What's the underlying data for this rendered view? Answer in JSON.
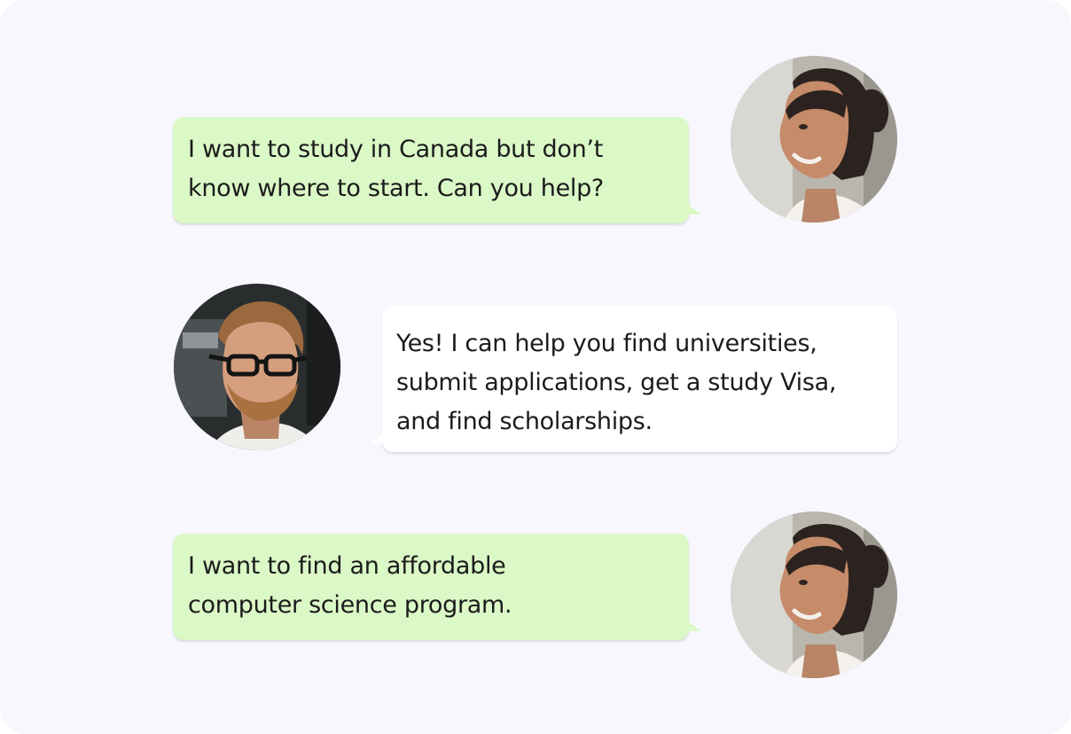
{
  "colors": {
    "background": "#f8f7fd",
    "user_bubble": "#dbf8c7",
    "agent_bubble": "#ffffff",
    "text": "#1b1b1b"
  },
  "messages": [
    {
      "sender": "student",
      "text": "I want to study in Canada but don’t\nknow where to start. Can you help?",
      "avatar_icon": "student-avatar-icon"
    },
    {
      "sender": "advisor",
      "text": "Yes! I can help you find universities,\nsubmit applications, get a study Visa,\nand find scholarships.",
      "avatar_icon": "advisor-avatar-icon"
    },
    {
      "sender": "student",
      "text": "I want to find an affordable\ncomputer science program.",
      "avatar_icon": "student-avatar-icon"
    }
  ]
}
